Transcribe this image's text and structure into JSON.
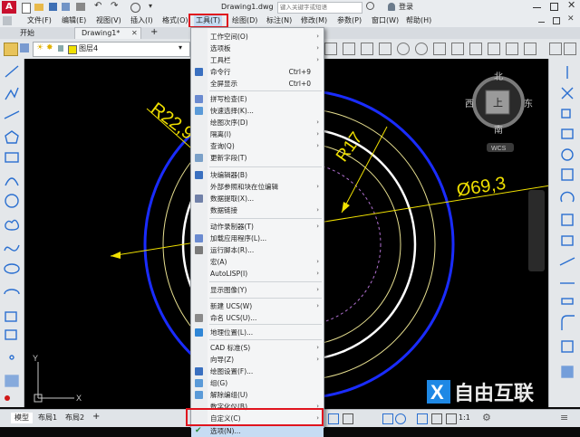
{
  "titlebar": {
    "doc_title": "Drawing1.dwg",
    "search_placeholder": "键入关键字或短语",
    "login_label": "登录"
  },
  "menubar": {
    "items": [
      "文件(F)",
      "编辑(E)",
      "视图(V)",
      "插入(I)",
      "格式(O)",
      "工具(T)",
      "绘图(D)",
      "标注(N)",
      "修改(M)",
      "参数(P)",
      "窗口(W)",
      "帮助(H)"
    ]
  },
  "tabs": {
    "start": "开始",
    "drawing": "Drawing1*",
    "add": "+"
  },
  "properties": {
    "layer_name": "图层4"
  },
  "viewcube": {
    "north": "北",
    "south": "南",
    "east": "东",
    "west": "西",
    "top": "上",
    "wcs": "WCS"
  },
  "drawing": {
    "dim_radius1": "R22,9",
    "dim_radius2": "R17",
    "dim_diameter": "Ø69,3",
    "axis_y": "Y",
    "axis_x": "X"
  },
  "status": {
    "model_tab": "模型",
    "layout1": "布局1",
    "layout2": "布局2",
    "scale": "1:1"
  },
  "watermark": "自由互联",
  "colors": {
    "accent_red": "#e0141e",
    "dim_yellow": "#f0e000",
    "circle_blue": "#1a2cff",
    "selected_blue": "#c6dcf3"
  },
  "tools_menu": {
    "items": [
      {
        "label": "工作空间(O)",
        "shortcut": "",
        "submenu": true,
        "icon": ""
      },
      {
        "label": "选项板",
        "shortcut": "",
        "submenu": true,
        "icon": ""
      },
      {
        "label": "工具栏",
        "shortcut": "",
        "submenu": true,
        "icon": ""
      },
      {
        "label": "命令行",
        "shortcut": "Ctrl+9",
        "submenu": false,
        "icon": "command-line-icon"
      },
      {
        "label": "全屏显示",
        "shortcut": "Ctrl+0",
        "submenu": false,
        "icon": ""
      },
      {
        "label": "拼写检查(E)",
        "shortcut": "",
        "submenu": false,
        "icon": "spell-check-icon"
      },
      {
        "label": "快速选择(K)...",
        "shortcut": "",
        "submenu": false,
        "icon": "quick-select-icon"
      },
      {
        "label": "绘图次序(D)",
        "shortcut": "",
        "submenu": true,
        "icon": ""
      },
      {
        "label": "隔离(I)",
        "shortcut": "",
        "submenu": true,
        "icon": ""
      },
      {
        "label": "查询(Q)",
        "shortcut": "",
        "submenu": true,
        "icon": ""
      },
      {
        "label": "更新字段(T)",
        "shortcut": "",
        "submenu": false,
        "icon": "update-field-icon"
      },
      {
        "label": "块编辑器(B)",
        "shortcut": "",
        "submenu": false,
        "icon": "block-editor-icon"
      },
      {
        "label": "外部参照和块在位编辑",
        "shortcut": "",
        "submenu": true,
        "icon": ""
      },
      {
        "label": "数据提取(X)...",
        "shortcut": "",
        "submenu": false,
        "icon": "data-extraction-icon"
      },
      {
        "label": "数据链接",
        "shortcut": "",
        "submenu": true,
        "icon": ""
      },
      {
        "label": "动作录制器(T)",
        "shortcut": "",
        "submenu": true,
        "icon": ""
      },
      {
        "label": "加载应用程序(L)...",
        "shortcut": "",
        "submenu": false,
        "icon": "load-app-icon"
      },
      {
        "label": "运行脚本(R)...",
        "shortcut": "",
        "submenu": false,
        "icon": "run-script-icon"
      },
      {
        "label": "宏(A)",
        "shortcut": "",
        "submenu": true,
        "icon": ""
      },
      {
        "label": "AutoLISP(I)",
        "shortcut": "",
        "submenu": true,
        "icon": ""
      },
      {
        "label": "显示图像(Y)",
        "shortcut": "",
        "submenu": true,
        "icon": ""
      },
      {
        "label": "新建 UCS(W)",
        "shortcut": "",
        "submenu": true,
        "icon": ""
      },
      {
        "label": "命名 UCS(U)...",
        "shortcut": "",
        "submenu": false,
        "icon": "named-ucs-icon"
      },
      {
        "label": "地理位置(L)...",
        "shortcut": "",
        "submenu": false,
        "icon": "geolocation-icon"
      },
      {
        "label": "CAD 标准(S)",
        "shortcut": "",
        "submenu": true,
        "icon": ""
      },
      {
        "label": "向导(Z)",
        "shortcut": "",
        "submenu": true,
        "icon": ""
      },
      {
        "label": "绘图设置(F)...",
        "shortcut": "",
        "submenu": false,
        "icon": "drafting-settings-icon"
      },
      {
        "label": "组(G)",
        "shortcut": "",
        "submenu": false,
        "icon": "group-icon"
      },
      {
        "label": "解除编组(U)",
        "shortcut": "",
        "submenu": false,
        "icon": "ungroup-icon"
      },
      {
        "label": "数字化仪(B)",
        "shortcut": "",
        "submenu": true,
        "icon": ""
      },
      {
        "label": "自定义(C)",
        "shortcut": "",
        "submenu": true,
        "icon": ""
      },
      {
        "label": "选项(N)...",
        "shortcut": "",
        "submenu": false,
        "icon": "options-check-icon"
      }
    ]
  }
}
